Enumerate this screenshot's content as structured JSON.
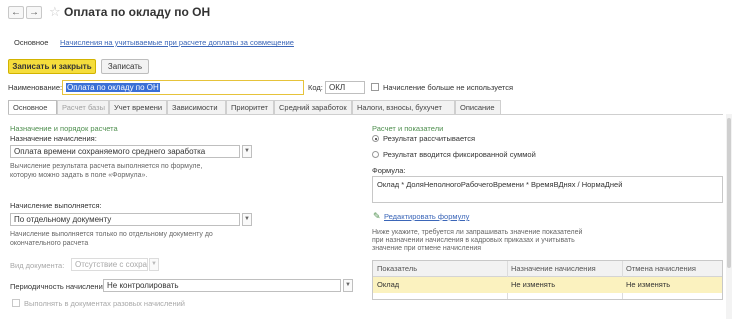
{
  "window": {
    "title": "Оплата по окладу по ОН",
    "back_glyph": "←",
    "forward_glyph": "→",
    "star_glyph": "☆"
  },
  "topnav": {
    "main_label": "Основное",
    "link_label": "Начисления на учитываемые при расчете доплаты за совмещение"
  },
  "toolbar": {
    "save_close_label": "Записать и закрыть",
    "save_label": "Записать"
  },
  "form": {
    "name_label": "Наименование:",
    "name_value": "Оплата по окладу по ОН",
    "code_label": "Код:",
    "code_value": "ОКЛ",
    "not_used_label": "Начисление больше не используется"
  },
  "tabs": [
    {
      "label": "Основное"
    },
    {
      "label": "Расчет базы"
    },
    {
      "label": "Учет времени"
    },
    {
      "label": "Зависимости"
    },
    {
      "label": "Приоритет"
    },
    {
      "label": "Средний заработок"
    },
    {
      "label": "Налоги, взносы, бухучет"
    },
    {
      "label": "Описание"
    }
  ],
  "left": {
    "section_title": "Назначение и порядок расчета",
    "purpose_label": "Назначение начисления:",
    "purpose_value": "Оплата времени сохраняемого среднего заработка",
    "purpose_note_1": "Вычисление результата расчета выполняется по формуле,",
    "purpose_note_2": "которую можно задать в поле «Формула».",
    "executed_label": "Начисление выполняется:",
    "executed_value": "По отдельному документу",
    "executed_note_1": "Начисление выполняется только по отдельному документу до",
    "executed_note_2": "окончательного расчета",
    "doc_type_label": "Вид документа:",
    "doc_type_value": "Отсутствие с сохранением",
    "periodicity_label": "Периодичность начисления:",
    "periodicity_value": "Не контролировать",
    "batch_label": "Выполнять в документах разовых начислений"
  },
  "right": {
    "section_title": "Расчет и показатели",
    "radio_formula": "Результат рассчитывается",
    "radio_fixed": "Результат вводится фиксированной суммой",
    "formula_label": "Формула:",
    "formula_value": "Оклад * ДоляНеполногоРабочегоВремени * ВремяВДнях / НормаДней",
    "edit_formula_link": "Редактировать формулу",
    "indicators_note_1": "Ниже укажите, требуется ли запрашивать значение показателей",
    "indicators_note_2": "при назначении начисления в кадровых приказах и учитывать",
    "indicators_note_3": "значение при отмене начисления",
    "table": {
      "headers": [
        "Показатель",
        "Назначение начисления",
        "Отмена начисления"
      ],
      "rows": [
        [
          "Оклад",
          "Не изменять",
          "Не изменять"
        ]
      ]
    }
  },
  "colors": {
    "primary_button": "#f5dd3c",
    "selected_row": "#fbf2bf",
    "section_title": "#4e8f4e",
    "link": "#3b66b8",
    "name_highlight": "#3a6fd6"
  }
}
